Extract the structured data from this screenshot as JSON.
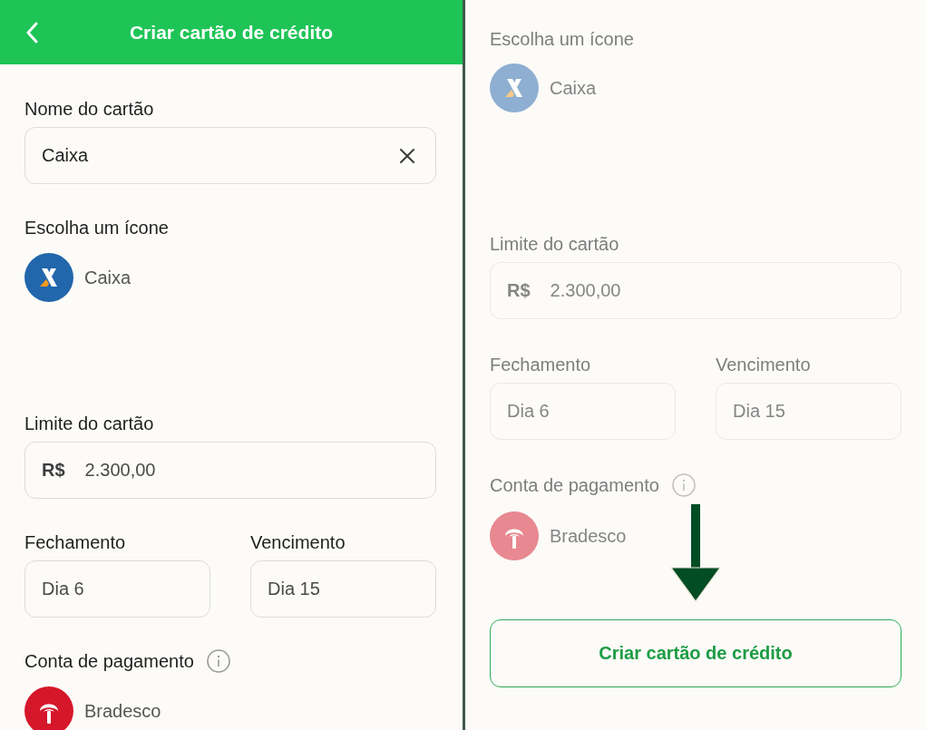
{
  "header": {
    "title": "Criar cartão de crédito"
  },
  "form": {
    "name_field": {
      "label": "Nome do cartão",
      "value": "Caixa"
    },
    "icon_picker": {
      "label": "Escolha um ícone",
      "bank": "Caixa"
    },
    "limit_field": {
      "label": "Limite do cartão",
      "prefix": "R$",
      "value": "2.300,00"
    },
    "closing_field": {
      "label": "Fechamento",
      "value": "Dia 6"
    },
    "due_field": {
      "label": "Vencimento",
      "value": "Dia 15"
    },
    "payment_account": {
      "label": "Conta de pagamento",
      "bank": "Bradesco"
    }
  },
  "scrolled_preview": {
    "dimmed": true,
    "icon_picker": {
      "label": "Escolha um ícone",
      "bank": "Caixa"
    },
    "limit_field": {
      "label": "Limite do cartão",
      "prefix": "R$",
      "value": "2.300,00"
    },
    "closing_field": {
      "label": "Fechamento",
      "value": "Dia 6"
    },
    "due_field": {
      "label": "Vencimento",
      "value": "Dia 15"
    },
    "payment_account": {
      "label": "Conta de pagamento",
      "bank": "Bradesco"
    },
    "submit_button": {
      "label": "Criar cartão de crédito"
    }
  }
}
